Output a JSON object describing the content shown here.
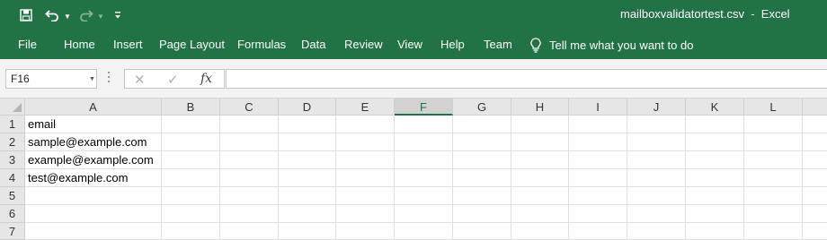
{
  "title_bar": {
    "window_title": "mailboxvalidatortest.csv  -  Excel",
    "icons": {
      "save": "save-icon",
      "undo": "undo-icon",
      "redo": "redo-icon",
      "customize": "customize-qat-icon"
    }
  },
  "ribbon": {
    "tabs": [
      "File",
      "Home",
      "Insert",
      "Page Layout",
      "Formulas",
      "Data",
      "Review",
      "View",
      "Help",
      "Team"
    ],
    "tell_me": "Tell me what you want to do"
  },
  "formula_bar": {
    "name_box": "F16",
    "fx_label": "fx",
    "formula_value": ""
  },
  "sheet": {
    "columns": [
      "A",
      "B",
      "C",
      "D",
      "E",
      "F",
      "G",
      "H",
      "I",
      "J",
      "K",
      "L"
    ],
    "active_column": "F",
    "rows": [
      "1",
      "2",
      "3",
      "4",
      "5",
      "6",
      "7"
    ],
    "cells": {
      "A1": "email",
      "A2": "sample@example.com",
      "A3": "example@example.com",
      "A4": "test@example.com"
    }
  },
  "colors": {
    "brand_green": "#217346",
    "header_gray": "#e6e6e6",
    "gridline": "#e1e1e1"
  }
}
